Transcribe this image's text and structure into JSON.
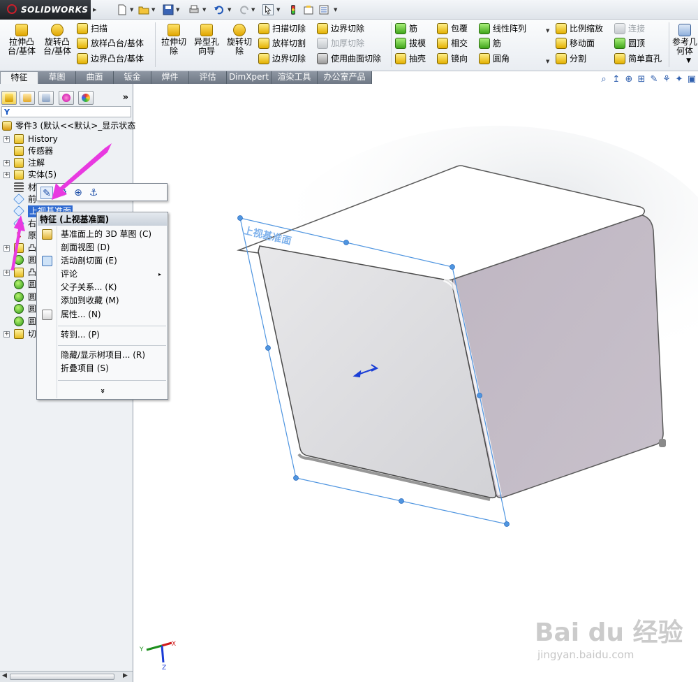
{
  "app": {
    "logo_text": "SOLIDWORKS",
    "logo_prefix": "3S"
  },
  "ribbon": {
    "extrude_boss": "拉伸凸台/基体",
    "revolve_boss": "旋转凸台/基体",
    "sweep": "扫描",
    "loft_boss": "放样凸台/基体",
    "boundary_boss": "边界凸台/基体",
    "extrude_cut": "拉伸切除",
    "hole_wizard": "异型孔向导",
    "revolve_cut": "旋转切除",
    "swept_cut": "扫描切除",
    "lofted_cut": "放样切割",
    "boundary_cut": "边界切除",
    "boundary_cut2": "边界切除",
    "thicken_cut": "加厚切除",
    "surface_cut": "使用曲面切除",
    "rib": "筋",
    "draft": "拔模",
    "shell": "抽壳",
    "wrap": "包覆",
    "intersect": "相交",
    "mirror": "镜向",
    "linear_pattern": "线性阵列",
    "rib2": "筋",
    "fillet": "圆角",
    "scale": "比例缩放",
    "move_face": "移动面",
    "split": "分割",
    "connect": "连接",
    "dome": "圆顶",
    "simple_hole": "简单直孔",
    "reference_geometry": "参考几何体"
  },
  "tabs": [
    "特征",
    "草图",
    "曲面",
    "钣金",
    "焊件",
    "评估",
    "DimXpert",
    "渲染工具",
    "办公室产品"
  ],
  "panel": {
    "collapse": "»",
    "filter_icon": "Y"
  },
  "tree": {
    "root": "零件3 (默认<<默认>_显示状态",
    "items": [
      {
        "label": "History",
        "exp": "+"
      },
      {
        "label": "传感器",
        "exp": ""
      },
      {
        "label": "注解",
        "exp": "+"
      },
      {
        "label": "实体(5)",
        "exp": "+"
      },
      {
        "label": "材",
        "exp": ""
      },
      {
        "label": "前",
        "exp": ""
      },
      {
        "label": "上视基准面",
        "exp": ""
      },
      {
        "label": "右",
        "exp": ""
      },
      {
        "label": "原",
        "exp": ""
      },
      {
        "label": "凸",
        "exp": "+"
      },
      {
        "label": "圆",
        "exp": ""
      },
      {
        "label": "凸",
        "exp": "+"
      },
      {
        "label": "圆",
        "exp": ""
      },
      {
        "label": "圆",
        "exp": ""
      },
      {
        "label": "圆",
        "exp": ""
      },
      {
        "label": "圆",
        "exp": ""
      },
      {
        "label": "切",
        "exp": "+"
      }
    ]
  },
  "context_menu": {
    "header": "特征 (上视基准面)",
    "items": [
      {
        "label": "基准面上的 3D 草图 (C)"
      },
      {
        "label": "剖面视图 (D)"
      },
      {
        "label": "活动剖切面 (E)"
      },
      {
        "label": "评论",
        "submenu": "▸"
      },
      {
        "label": "父子关系... (K)"
      },
      {
        "label": "添加到收藏 (M)"
      },
      {
        "label": "属性... (N)"
      },
      {
        "label": "转到... (P)"
      },
      {
        "label": "隐藏/显示树项目... (R)"
      },
      {
        "label": "折叠项目 (S)"
      }
    ],
    "expand": "»"
  },
  "graphics": {
    "plane_label": "上视基准面"
  },
  "triad": {
    "x": "X",
    "y": "Y",
    "z": "Z"
  },
  "watermark": {
    "brand": "Bai du 经验",
    "url": "jingyan.baidu.com"
  }
}
